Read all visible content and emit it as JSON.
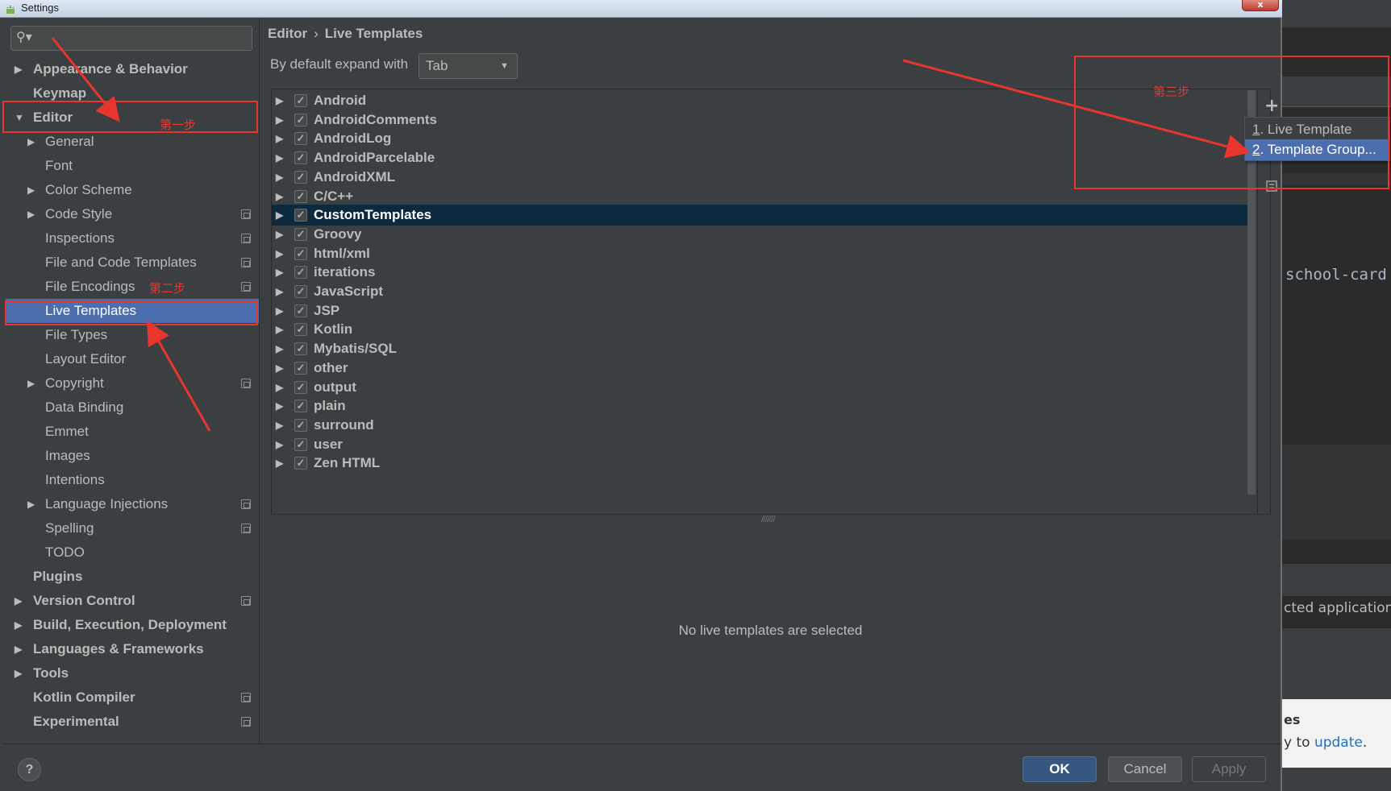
{
  "window": {
    "title": "Settings",
    "close_label": "x"
  },
  "search": {
    "placeholder": "",
    "icon": "search-icon"
  },
  "sidebar": {
    "items": [
      {
        "label": "Appearance & Behavior",
        "level": 0,
        "expandable": true,
        "expanded": false
      },
      {
        "label": "Keymap",
        "level": 0
      },
      {
        "label": "Editor",
        "level": 0,
        "expandable": true,
        "expanded": true
      },
      {
        "label": "General",
        "level": 1,
        "expandable": true
      },
      {
        "label": "Font",
        "level": 1
      },
      {
        "label": "Color Scheme",
        "level": 1,
        "expandable": true
      },
      {
        "label": "Code Style",
        "level": 1,
        "expandable": true,
        "project_icon": true
      },
      {
        "label": "Inspections",
        "level": 1,
        "project_icon": true
      },
      {
        "label": "File and Code Templates",
        "level": 1,
        "project_icon": true
      },
      {
        "label": "File Encodings",
        "level": 1,
        "project_icon": true
      },
      {
        "label": "Live Templates",
        "level": 1,
        "selected": true
      },
      {
        "label": "File Types",
        "level": 1
      },
      {
        "label": "Layout Editor",
        "level": 1
      },
      {
        "label": "Copyright",
        "level": 1,
        "expandable": true,
        "project_icon": true
      },
      {
        "label": "Data Binding",
        "level": 1
      },
      {
        "label": "Emmet",
        "level": 1
      },
      {
        "label": "Images",
        "level": 1
      },
      {
        "label": "Intentions",
        "level": 1
      },
      {
        "label": "Language Injections",
        "level": 1,
        "expandable": true,
        "project_icon": true
      },
      {
        "label": "Spelling",
        "level": 1,
        "project_icon": true
      },
      {
        "label": "TODO",
        "level": 1
      },
      {
        "label": "Plugins",
        "level": 0
      },
      {
        "label": "Version Control",
        "level": 0,
        "expandable": true,
        "project_icon": true
      },
      {
        "label": "Build, Execution, Deployment",
        "level": 0,
        "expandable": true
      },
      {
        "label": "Languages & Frameworks",
        "level": 0,
        "expandable": true
      },
      {
        "label": "Tools",
        "level": 0,
        "expandable": true
      },
      {
        "label": "Kotlin Compiler",
        "level": 0,
        "project_icon": true
      },
      {
        "label": "Experimental",
        "level": 0,
        "project_icon": true
      }
    ]
  },
  "breadcrumb": {
    "parent": "Editor",
    "separator": "›",
    "current": "Live Templates"
  },
  "expand": {
    "label": "By default expand with",
    "value": "Tab"
  },
  "templates": {
    "groups": [
      {
        "name": "Android",
        "checked": true
      },
      {
        "name": "AndroidComments",
        "checked": true
      },
      {
        "name": "AndroidLog",
        "checked": true
      },
      {
        "name": "AndroidParcelable",
        "checked": true
      },
      {
        "name": "AndroidXML",
        "checked": true
      },
      {
        "name": "C/C++",
        "checked": true
      },
      {
        "name": "CustomTemplates",
        "checked": true,
        "selected": true
      },
      {
        "name": "Groovy",
        "checked": true
      },
      {
        "name": "html/xml",
        "checked": true
      },
      {
        "name": "iterations",
        "checked": true
      },
      {
        "name": "JavaScript",
        "checked": true
      },
      {
        "name": "JSP",
        "checked": true
      },
      {
        "name": "Kotlin",
        "checked": true
      },
      {
        "name": "Mybatis/SQL",
        "checked": true
      },
      {
        "name": "other",
        "checked": true
      },
      {
        "name": "output",
        "checked": true
      },
      {
        "name": "plain",
        "checked": true
      },
      {
        "name": "surround",
        "checked": true
      },
      {
        "name": "user",
        "checked": true
      },
      {
        "name": "Zen HTML",
        "checked": true
      }
    ],
    "add_label": "+",
    "empty_message": "No live templates are selected"
  },
  "popup": {
    "items": [
      {
        "mnemonic": "1",
        "label": ". Live Template"
      },
      {
        "mnemonic": "2",
        "label": ". Template Group...",
        "selected": true
      }
    ]
  },
  "footer": {
    "help_label": "?",
    "ok_label": "OK",
    "cancel_label": "Cancel",
    "apply_label": "Apply"
  },
  "annotations": {
    "step1": "第一步",
    "step2": "第二步",
    "step3": "第三步",
    "color": "#e8352e"
  },
  "background_ide": {
    "code_text": "school-card",
    "app_text": "cted application",
    "notify_title": "es",
    "notify_prefix": "y to ",
    "notify_link": "update",
    "notify_suffix": "."
  }
}
